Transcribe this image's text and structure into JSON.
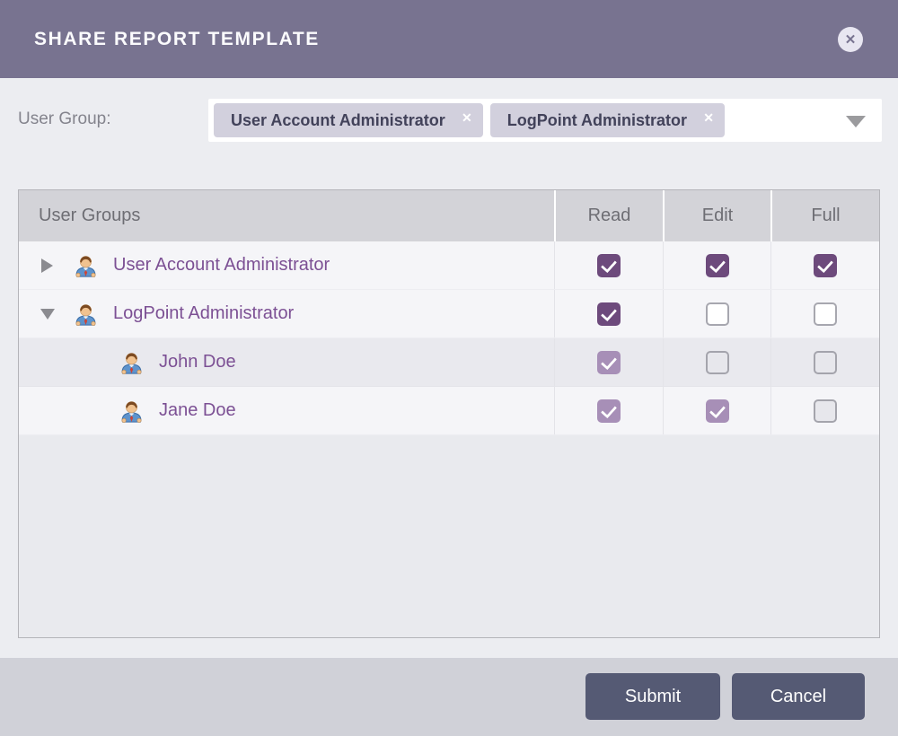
{
  "header": {
    "title": "SHARE REPORT TEMPLATE",
    "close_icon": "✕"
  },
  "form": {
    "user_group_label": "User Group:",
    "remove_icon": "✕",
    "selected_groups": [
      {
        "label": "User Account Administrator"
      },
      {
        "label": "LogPoint Administrator"
      }
    ]
  },
  "table": {
    "columns": [
      "User Groups",
      "Read",
      "Edit",
      "Full"
    ],
    "rows": [
      {
        "name": "User Account Administrator",
        "level": 0,
        "expanded": false,
        "read": {
          "checked": true,
          "disabled": false
        },
        "edit": {
          "checked": true,
          "disabled": false
        },
        "full": {
          "checked": true,
          "disabled": false
        }
      },
      {
        "name": "LogPoint Administrator",
        "level": 0,
        "expanded": true,
        "read": {
          "checked": true,
          "disabled": false
        },
        "edit": {
          "checked": false,
          "disabled": false
        },
        "full": {
          "checked": false,
          "disabled": false
        }
      },
      {
        "name": "John Doe",
        "level": 1,
        "read": {
          "checked": true,
          "disabled": true
        },
        "edit": {
          "checked": false,
          "disabled": true
        },
        "full": {
          "checked": false,
          "disabled": true
        }
      },
      {
        "name": "Jane Doe",
        "level": 1,
        "read": {
          "checked": true,
          "disabled": true
        },
        "edit": {
          "checked": true,
          "disabled": true
        },
        "full": {
          "checked": false,
          "disabled": true
        }
      }
    ]
  },
  "footer": {
    "submit_label": "Submit",
    "cancel_label": "Cancel"
  },
  "colors": {
    "header_bg": "#787390",
    "body_bg": "#ecedf1",
    "accent_checked": "#6d4a7c",
    "accent_checked_disabled": "#a78fb7",
    "row_text_purple": "#7c5094",
    "tag_bg": "#d2d0dd",
    "button_bg": "#555a74",
    "footer_bg": "#d0d1d8"
  }
}
